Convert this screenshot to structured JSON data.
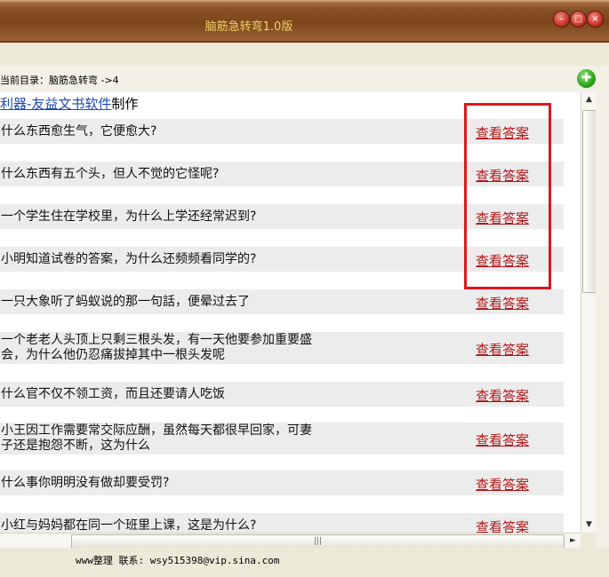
{
  "window": {
    "title": "脑筋急转弯1.0版"
  },
  "address": {
    "label": "当前目录：脑筋急转弯 ->4"
  },
  "credit": {
    "link_text": "利器-友益文书软件",
    "suffix": "制作"
  },
  "answer_label": "查看答案",
  "questions": [
    {
      "text": "什么东西愈生气，它便愈大?"
    },
    {
      "text": "什么东西有五个头，但人不觉的它怪呢?"
    },
    {
      "text": "一个学生住在学校里，为什么上学还经常迟到?"
    },
    {
      "text": "小明知道试卷的答案，为什么还频频看同学的?"
    },
    {
      "text": "一只大象听了蚂蚁说的那一句話，便晕过去了"
    },
    {
      "text": "一个老老人头顶上只剩三根头发，有一天他要参加重要盛",
      "text2": "会，为什么他仍忍痛拔掉其中一根头发呢"
    },
    {
      "text": "什么官不仅不领工资，而且还要请人吃饭"
    },
    {
      "text": "小王因工作需要常交际应酬，虽然每天都很早回家，可妻",
      "text2": "子还是抱怨不断，这为什么"
    },
    {
      "text": "什么事你明明没有做却要受罚?"
    },
    {
      "text": "小红与妈妈都在同一个班里上课，这是为什么?"
    }
  ],
  "status": {
    "text": "www整理 联系: wsy515398@vip.sina.com"
  }
}
